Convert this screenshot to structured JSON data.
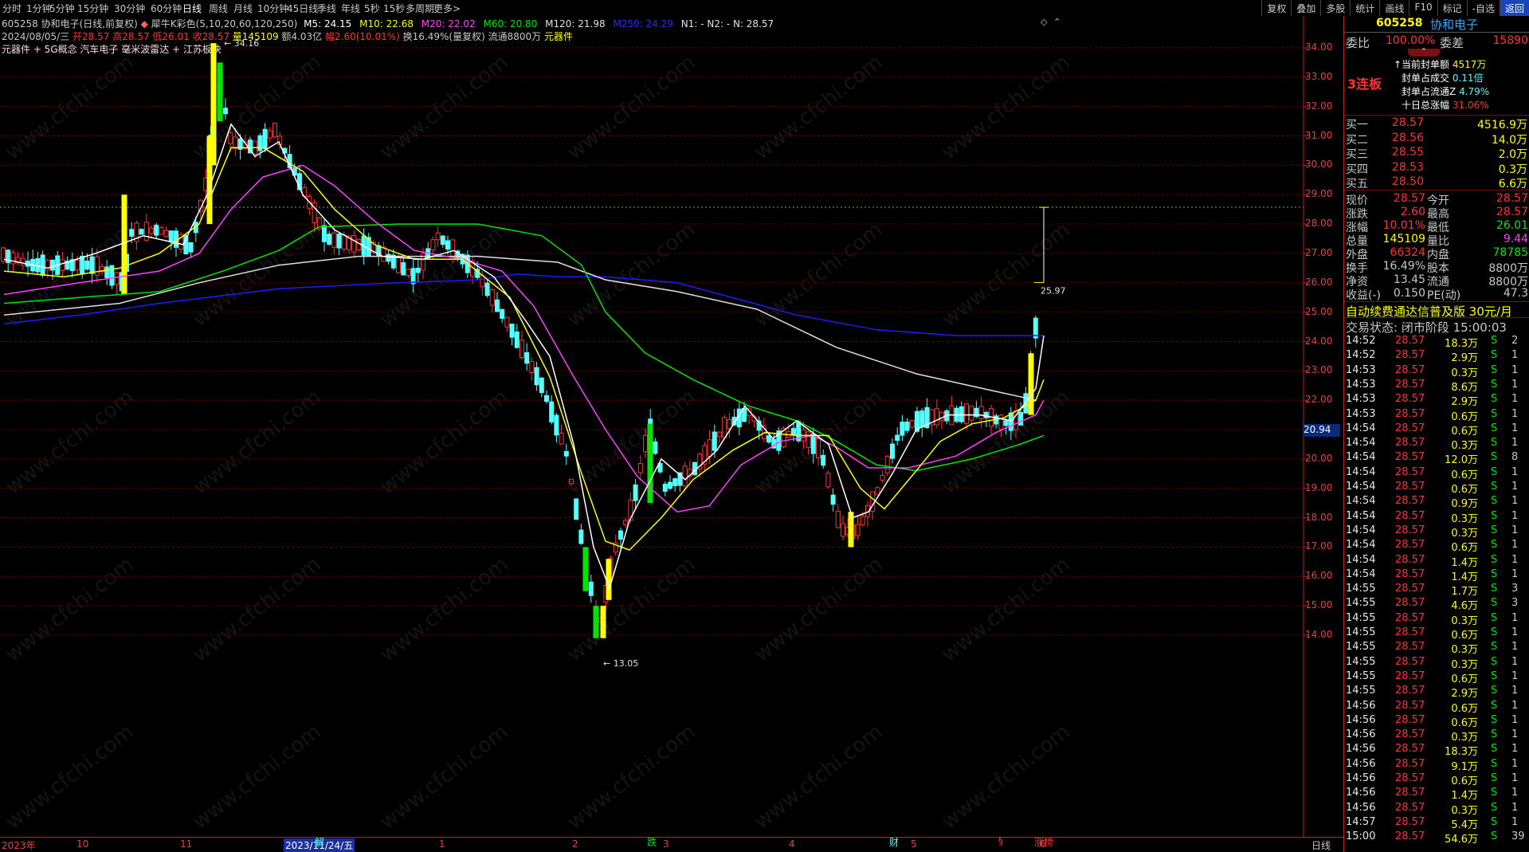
{
  "toolbar": {
    "periods": [
      "分时",
      "1分钟",
      "5分钟",
      "15分钟",
      "30分钟",
      "60分钟",
      "日线",
      "周线",
      "月线",
      "10分钟",
      "45日线",
      "季线",
      "年线",
      "5秒",
      "15秒",
      "多周期",
      "更多>"
    ],
    "active_period": "日线",
    "right_buttons": [
      "复权",
      "叠加",
      "多股",
      "统计",
      "画线",
      "F10",
      "标记",
      "-自选",
      "返回"
    ]
  },
  "info": {
    "line1": {
      "stock": "605258 协和电子(日线,前复权)",
      "indicator": "犀牛K彩色(5,10,20,60,120,250)",
      "ma5": "M5: 24.15",
      "ma10": "M10: 22.68",
      "ma20": "M20: 22.02",
      "ma60": "M60: 20.80",
      "ma120": "M120: 21.98",
      "ma250": "M250: 24.29",
      "n_values": "N1: -  N2: -  N: 28.57"
    },
    "line2": {
      "date": "2024/08/05/三",
      "open": "开28.57",
      "high": "高28.57",
      "low": "低26.01",
      "close": "收28.57",
      "volume": "量145109",
      "amount": "额4.03亿",
      "change": "幅2.60(10.01%)",
      "turnover": "换16.49%(量复权)",
      "float": "流通8800万",
      "sector": "元器件"
    },
    "line3": "元器件 + 5G概念 汽车电子 毫米波雷达 + 江苏板块"
  },
  "chart": {
    "y_ticks": [
      "34.00",
      "33.00",
      "32.00",
      "31.00",
      "30.00",
      "29.00",
      "28.00",
      "27.00",
      "26.00",
      "25.00",
      "24.00",
      "23.00",
      "22.00",
      "21.00",
      "20.00",
      "19.00",
      "18.00",
      "17.00",
      "16.00",
      "15.00",
      "14.00"
    ],
    "high_label": "34.16",
    "low_label": "13.05",
    "current_label": "20.94",
    "range_label": "25.97",
    "x_labels": [
      "2023年",
      "10",
      "11",
      "2023/11/24/五",
      "1",
      "2",
      "3",
      "4",
      "5",
      "6",
      "日线"
    ],
    "events": [
      "解",
      "跌",
      "财",
      "§",
      "涨榜"
    ],
    "watermark": "www.cfchi.com"
  },
  "panel": {
    "code": "605258",
    "name": "协和电子",
    "weibi_label": "委比",
    "weibi_value": "100.00%",
    "weicha_label": "委差",
    "weicha_value": "15890",
    "board_tag": "3连板",
    "seal_amount_label": "↑当前封单额",
    "seal_amount_value": "4517万",
    "seal_trade_label": "封单占成交",
    "seal_trade_value": "0.11倍",
    "seal_float_label": "封单占流通Z",
    "seal_float_value": "4.79%",
    "ten_day_label": "十日总涨幅",
    "ten_day_value": "31.06%",
    "bids": [
      {
        "label": "买一",
        "price": "28.57",
        "vol": "4516.9万"
      },
      {
        "label": "买二",
        "price": "28.56",
        "vol": "14.0万"
      },
      {
        "label": "买三",
        "price": "28.55",
        "vol": "2.0万"
      },
      {
        "label": "买四",
        "price": "28.53",
        "vol": "0.3万"
      },
      {
        "label": "买五",
        "price": "28.50",
        "vol": "6.6万"
      }
    ],
    "quote": [
      {
        "l1": "现价",
        "v1": "28.57",
        "l2": "今开",
        "v2": "28.57"
      },
      {
        "l1": "涨跌",
        "v1": "2.60",
        "l2": "最高",
        "v2": "28.57"
      },
      {
        "l1": "涨幅",
        "v1": "10.01%",
        "l2": "最低",
        "v2": "26.01"
      },
      {
        "l1": "总量",
        "v1": "145109",
        "l2": "量比",
        "v2": "9.44"
      },
      {
        "l1": "外盘",
        "v1": "66324",
        "l2": "内盘",
        "v2": "78785"
      },
      {
        "l1": "换手",
        "v1": "16.49%",
        "l2": "股本",
        "v2": "8800万"
      },
      {
        "l1": "净资",
        "v1": "13.45",
        "l2": "流通",
        "v2": "8800万"
      },
      {
        "l1": "收益(-)",
        "v1": "0.150",
        "l2": "PE(动)",
        "v2": "47.3"
      }
    ],
    "ad": "自动续费通达信普及版  30元/月",
    "status": "交易状态: 闭市阶段 15:00:03",
    "ticks": [
      [
        "14:52",
        "28.57",
        "18.3万",
        "S",
        "2"
      ],
      [
        "14:52",
        "28.57",
        "2.9万",
        "S",
        "1"
      ],
      [
        "14:53",
        "28.57",
        "0.3万",
        "S",
        "1"
      ],
      [
        "14:53",
        "28.57",
        "8.6万",
        "S",
        "1"
      ],
      [
        "14:53",
        "28.57",
        "2.9万",
        "S",
        "1"
      ],
      [
        "14:53",
        "28.57",
        "0.6万",
        "S",
        "1"
      ],
      [
        "14:54",
        "28.57",
        "0.6万",
        "S",
        "1"
      ],
      [
        "14:54",
        "28.57",
        "0.3万",
        "S",
        "1"
      ],
      [
        "14:54",
        "28.57",
        "12.0万",
        "S",
        "8"
      ],
      [
        "14:54",
        "28.57",
        "0.6万",
        "S",
        "1"
      ],
      [
        "14:54",
        "28.57",
        "0.6万",
        "S",
        "1"
      ],
      [
        "14:54",
        "28.57",
        "0.9万",
        "S",
        "1"
      ],
      [
        "14:54",
        "28.57",
        "0.3万",
        "S",
        "1"
      ],
      [
        "14:54",
        "28.57",
        "0.3万",
        "S",
        "1"
      ],
      [
        "14:54",
        "28.57",
        "0.6万",
        "S",
        "1"
      ],
      [
        "14:54",
        "28.57",
        "1.4万",
        "S",
        "1"
      ],
      [
        "14:54",
        "28.57",
        "1.4万",
        "S",
        "1"
      ],
      [
        "14:55",
        "28.57",
        "1.7万",
        "S",
        "3"
      ],
      [
        "14:55",
        "28.57",
        "4.6万",
        "S",
        "3"
      ],
      [
        "14:55",
        "28.57",
        "0.3万",
        "S",
        "1"
      ],
      [
        "14:55",
        "28.57",
        "0.6万",
        "S",
        "1"
      ],
      [
        "14:55",
        "28.57",
        "0.3万",
        "S",
        "1"
      ],
      [
        "14:55",
        "28.57",
        "0.3万",
        "S",
        "1"
      ],
      [
        "14:55",
        "28.57",
        "0.6万",
        "S",
        "1"
      ],
      [
        "14:55",
        "28.57",
        "2.9万",
        "S",
        "1"
      ],
      [
        "14:56",
        "28.57",
        "0.6万",
        "S",
        "1"
      ],
      [
        "14:56",
        "28.57",
        "0.6万",
        "S",
        "1"
      ],
      [
        "14:56",
        "28.57",
        "0.3万",
        "S",
        "1"
      ],
      [
        "14:56",
        "28.57",
        "18.3万",
        "S",
        "1"
      ],
      [
        "14:56",
        "28.57",
        "9.1万",
        "S",
        "1"
      ],
      [
        "14:56",
        "28.57",
        "0.6万",
        "S",
        "1"
      ],
      [
        "14:56",
        "28.57",
        "1.4万",
        "S",
        "1"
      ],
      [
        "14:56",
        "28.57",
        "0.3万",
        "S",
        "1"
      ],
      [
        "14:57",
        "28.57",
        "5.4万",
        "S",
        "1"
      ],
      [
        "15:00",
        "28.57",
        "54.6万",
        "S",
        "39"
      ]
    ]
  },
  "colors": {
    "up": "#ff3232",
    "down": "#54ffff",
    "ma5": "#ffffff",
    "ma10": "#ffff00",
    "ma20": "#ff40ff",
    "ma60": "#00e600",
    "ma120": "#e0e0e0",
    "ma250": "#1c1cff"
  }
}
